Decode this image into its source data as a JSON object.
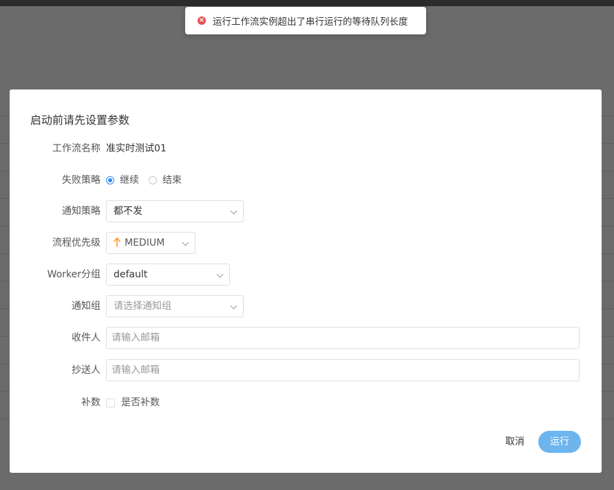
{
  "toast": {
    "icon": "error-icon",
    "message": "运行工作流实例超出了串行运行的等待队列长度"
  },
  "dialog": {
    "title": "启动前请先设置参数",
    "workflow_name": {
      "label": "工作流名称",
      "value": "准实时测试01"
    },
    "failure_strategy": {
      "label": "失败策略",
      "options": [
        {
          "label": "继续",
          "checked": true
        },
        {
          "label": "结束",
          "checked": false
        }
      ]
    },
    "notify_strategy": {
      "label": "通知策略",
      "value": "都不发"
    },
    "process_priority": {
      "label": "流程优先级",
      "value": "MEDIUM",
      "icon": "arrow-up-icon",
      "icon_color": "#ff9f3a"
    },
    "worker_group": {
      "label": "Worker分组",
      "value": "default"
    },
    "notify_group": {
      "label": "通知组",
      "placeholder": "请选择通知组"
    },
    "recipients": {
      "label": "收件人",
      "placeholder": "请输入邮箱"
    },
    "cc": {
      "label": "抄送人",
      "placeholder": "请输入邮箱"
    },
    "complement": {
      "label": "补数",
      "checkbox_label": "是否补数",
      "checked": false
    },
    "cancel_label": "取消",
    "run_label": "运行"
  },
  "colors": {
    "primary": "#2d8cf0",
    "run_button": "#6cb5ee",
    "error": "#e94e4e",
    "overlay": "#6b6b6b"
  }
}
